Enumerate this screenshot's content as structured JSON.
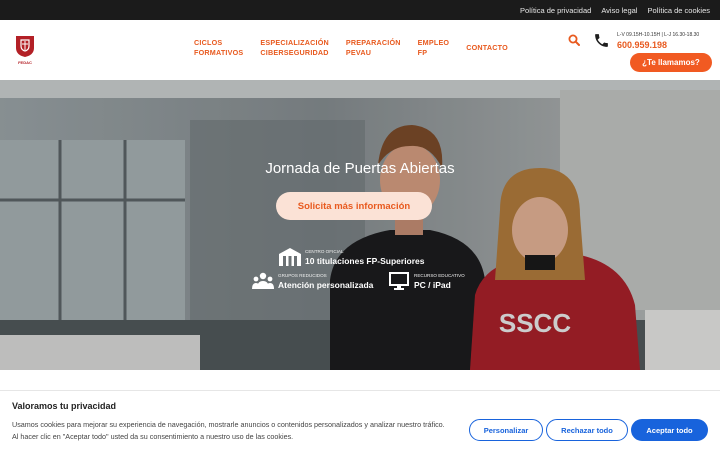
{
  "topbar": {
    "links": [
      "Política de privacidad",
      "Aviso legal",
      "Política de cookies"
    ]
  },
  "header": {
    "logo_text": "FEDAC",
    "nav": [
      {
        "label": "CICLOS\nFORMATIVOS"
      },
      {
        "label": "ESPECIALIZACIÓN\nCIBERSEGURIDAD"
      },
      {
        "label": "PREPARACIÓN\nPEVAU"
      },
      {
        "label": "EMPLEO\nFP"
      },
      {
        "label": "CONTACTO"
      }
    ],
    "hours": "L-V 09.15H-10.15H | L-J 16.30-18.30",
    "phone": "600.959.198",
    "callme_label": "¿Te llamamos?"
  },
  "hero": {
    "title": "Jornada de Puertas Abiertas",
    "cta_label": "Solicita más información",
    "hoodie_text": "SSCC",
    "features": [
      {
        "small": "CENTRO OFICIAL",
        "big": "10 titulaciones FP-Superiores",
        "icon": "school-building-icon"
      },
      {
        "small": "GRUPOS REDUCIDOS",
        "big": "Atención personalizada",
        "icon": "group-icon"
      },
      {
        "small": "RECURSO EDUCATIVO",
        "big": "PC / iPad",
        "icon": "monitor-icon"
      }
    ]
  },
  "cookie_banner": {
    "title": "Valoramos tu privacidad",
    "text": "Usamos cookies para mejorar su experiencia de navegación, mostrarle anuncios o contenidos personalizados y analizar nuestro tráfico. Al hacer clic en \"Aceptar todo\" usted da su consentimiento a nuestro uso de las cookies.",
    "customize_label": "Personalizar",
    "reject_label": "Rechazar todo",
    "accept_label": "Aceptar todo"
  },
  "colors": {
    "accent": "#f15a22",
    "nav_text": "#e85a1f",
    "cookie_blue": "#1863dc",
    "topbar": "#1b1b1b"
  }
}
